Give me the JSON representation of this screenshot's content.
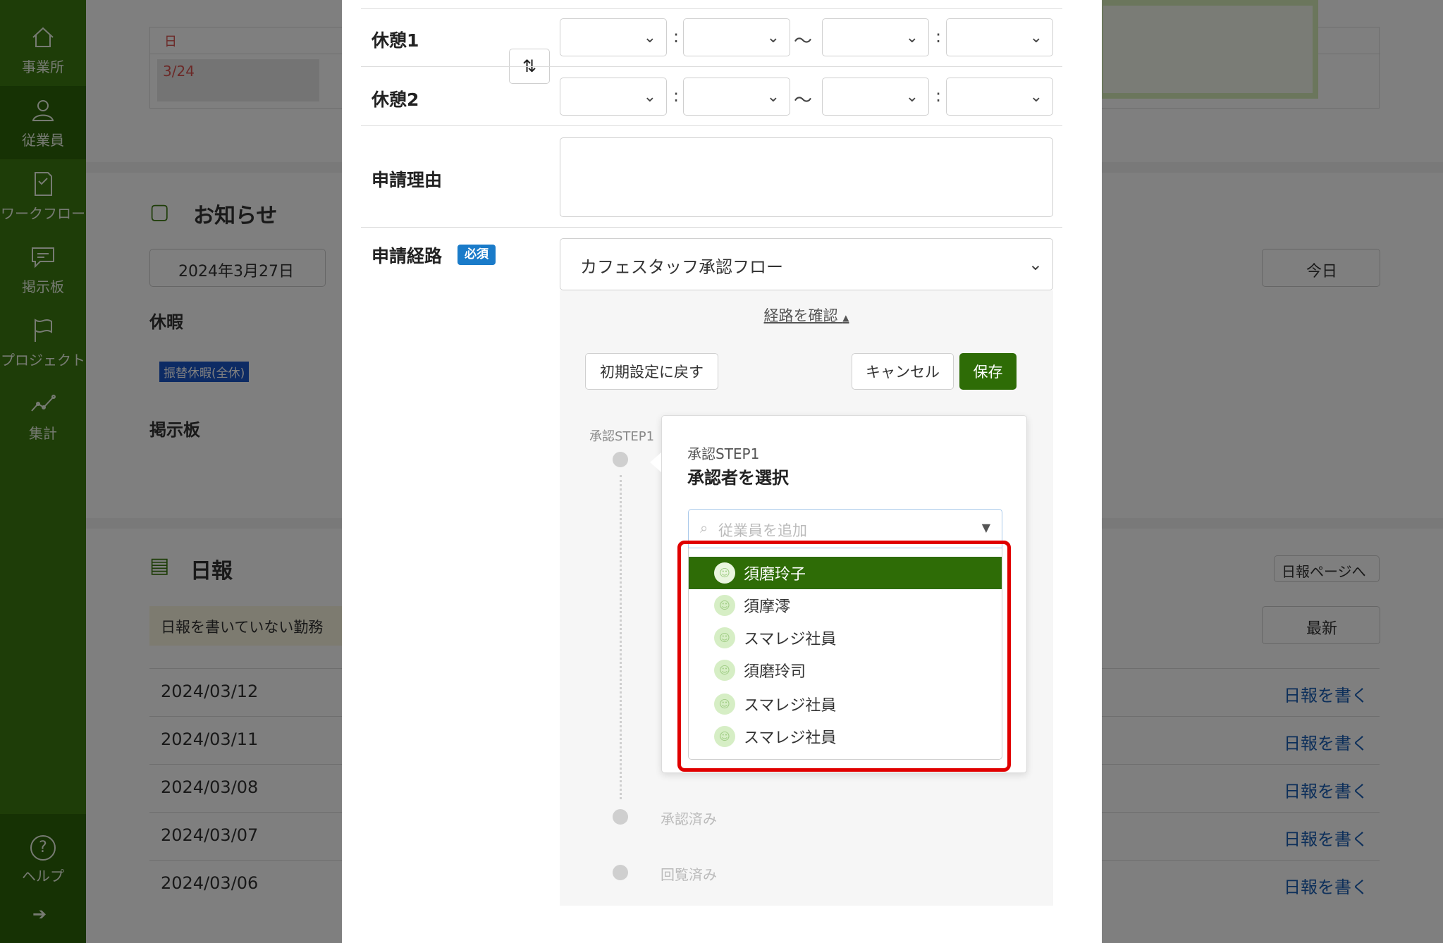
{
  "sidebar": {
    "items": [
      {
        "label": "事業所",
        "icon": "home-icon"
      },
      {
        "label": "従業員",
        "icon": "person-icon"
      },
      {
        "label": "ワークフロー",
        "icon": "workflow-icon"
      },
      {
        "label": "掲示板",
        "icon": "message-icon"
      },
      {
        "label": "プロジェクト",
        "icon": "flag-icon"
      },
      {
        "label": "集計",
        "icon": "chart-icon"
      }
    ],
    "help_label": "ヘルプ",
    "help_glyph": "?",
    "expand_glyph": "➔"
  },
  "background": {
    "calendar_day_header": "日",
    "calendar_date": "3/24",
    "notice_title": "お知らせ",
    "date_selector": "2024年3月27日",
    "vacation_heading": "休暇",
    "vacation_badge": "振替休暇(全休)",
    "board_heading": "掲示板",
    "daily_title": "日報",
    "daily_warning": "日報を書いていない勤務",
    "daily_page_button": "日報ページへ",
    "today_button": "今日",
    "latest_button": "最新",
    "daily_rows": [
      {
        "date": "2024/03/12",
        "action": "日報を書く"
      },
      {
        "date": "2024/03/11",
        "action": "日報を書く"
      },
      {
        "date": "2024/03/08",
        "action": "日報を書く"
      },
      {
        "date": "2024/03/07",
        "action": "日報を書く"
      },
      {
        "date": "2024/03/06",
        "action": "日報を書く"
      }
    ]
  },
  "modal": {
    "break1_label": "休憩1",
    "break2_label": "休憩2",
    "reason_label": "申請理由",
    "route_label": "申請経路",
    "required_badge": "必須",
    "route_value": "カフェスタッフ承認フロー",
    "check_route_link": "経路を確認",
    "reset_button": "初期設定に戻す",
    "cancel_button": "キャンセル",
    "save_button": "保存",
    "step_side_label": "承認STEP1",
    "approved_label": "承認済み",
    "viewed_label": "回覧済み",
    "colon": ":",
    "tilde": "〜",
    "chevron": "⌄"
  },
  "approver_card": {
    "step_label": "承認STEP1",
    "title": "承認者を選択",
    "search_placeholder": "従業員を追加",
    "options": [
      {
        "name": "須磨玲子",
        "selected": true
      },
      {
        "name": "須摩澪",
        "selected": false
      },
      {
        "name": "スマレジ社員",
        "selected": false
      },
      {
        "name": "須磨玲司",
        "selected": false
      },
      {
        "name": "スマレジ社員",
        "selected": false
      },
      {
        "name": "スマレジ社員",
        "selected": false
      }
    ]
  },
  "colors": {
    "sidebar": "#3c7a10",
    "accent_green": "#2e6c06",
    "badge_blue": "#1a7bc9",
    "highlight_red": "#e00000",
    "link_blue": "#1a5fb4"
  }
}
